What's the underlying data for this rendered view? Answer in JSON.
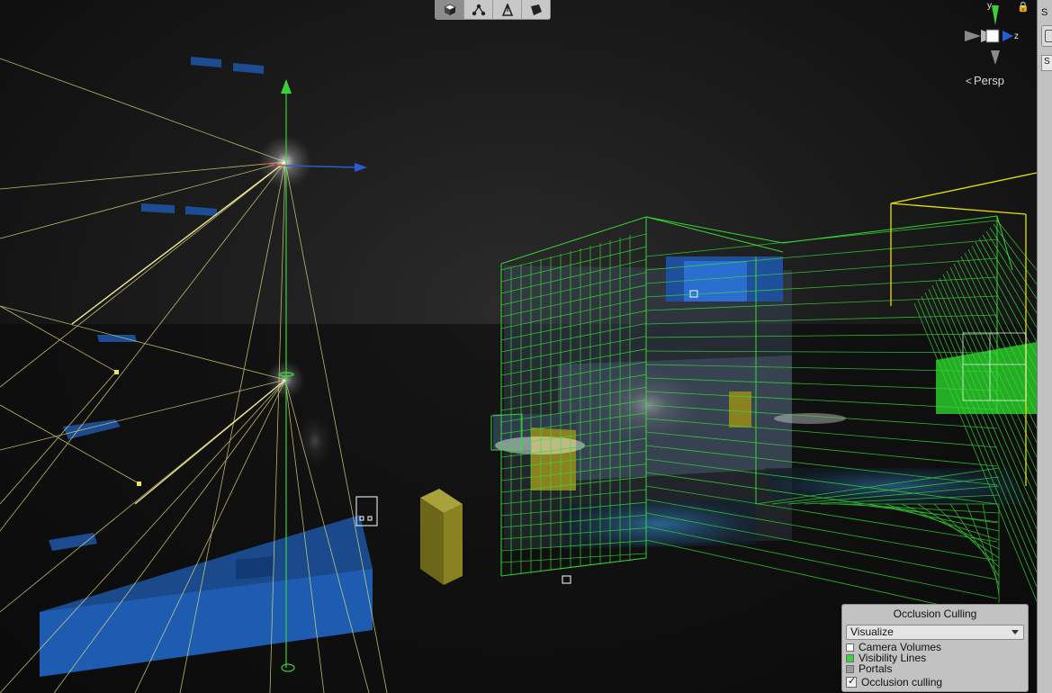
{
  "toolbar": {
    "tools": [
      {
        "name": "shaded",
        "icon": "shaded-cube-icon",
        "active": true
      },
      {
        "name": "scene-graph",
        "icon": "node-graph-icon",
        "active": false
      },
      {
        "name": "pen",
        "icon": "pen-tool-icon",
        "active": false
      },
      {
        "name": "wireframe",
        "icon": "wireframe-quad-icon",
        "active": false
      }
    ]
  },
  "gizmo": {
    "axis_y": "y",
    "axis_z": "z",
    "projection_label": "Persp",
    "projection_icon": "perspective-icon",
    "lock_icon": "lock-icon"
  },
  "inspector_strip": {
    "label_1": "S",
    "label_2": "S"
  },
  "occlusion_panel": {
    "title": "Occlusion Culling",
    "mode_value": "Visualize",
    "legend": [
      {
        "label": "Camera Volumes",
        "color": "#ffffff"
      },
      {
        "label": "Visibility Lines",
        "color": "#3fd23f"
      },
      {
        "label": "Portals",
        "color": "#9a9a9a"
      }
    ],
    "toggle_label": "Occlusion culling",
    "toggle_checked": true
  },
  "colors": {
    "visibility_green": "#36e036",
    "camera_yellow": "#e8e07a",
    "object_blue": "#1f4f9a",
    "object_yellow": "#8a8220",
    "axis_green": "#3ad13a",
    "axis_blue": "#2a5bd6",
    "axis_red": "#d03a2a"
  }
}
